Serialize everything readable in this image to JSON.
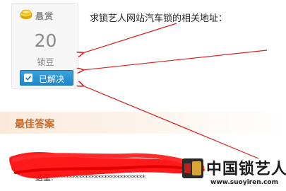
{
  "bounty": {
    "label": "悬赏",
    "value": "20",
    "unit": "锁豆",
    "status_button": "已解决"
  },
  "question": {
    "text": "求锁艺人网站汽车锁的相关地址："
  },
  "best_answer": {
    "title": "最佳答案",
    "prefix": "这里:",
    "masked_text": "****************************"
  },
  "watermark": {
    "title": "中国锁艺人",
    "url": "www.suoyiren.com"
  },
  "colors": {
    "accent_button": "#1f86c9",
    "best_answer_title": "#c86a26",
    "annotation_arrows": "#d42020",
    "redaction": "#ff0d0d"
  },
  "icons": [
    "coin-icon",
    "checkmark-icon"
  ]
}
